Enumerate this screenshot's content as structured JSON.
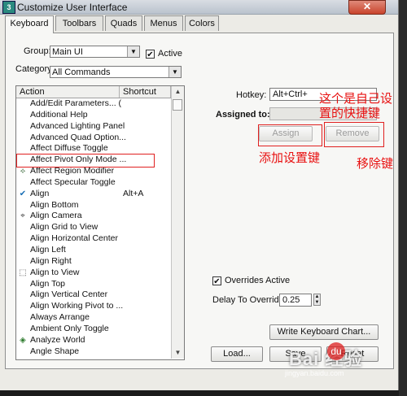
{
  "window": {
    "title": "Customize User Interface",
    "close_glyph": "✕",
    "app_icon": "3ds-max-icon"
  },
  "tabs": [
    {
      "label": "Keyboard",
      "active": true
    },
    {
      "label": "Toolbars",
      "active": false
    },
    {
      "label": "Quads",
      "active": false
    },
    {
      "label": "Menus",
      "active": false
    },
    {
      "label": "Colors",
      "active": false
    }
  ],
  "group": {
    "label": "Group:",
    "value": "Main UI",
    "active_label": "Active",
    "active_checked": true
  },
  "category": {
    "label": "Category:",
    "value": "All Commands"
  },
  "list": {
    "header_action": "Action",
    "header_shortcut": "Shortcut",
    "rows": [
      {
        "action": "Add/Edit Parameters... (",
        "shortcut": "",
        "icon": ""
      },
      {
        "action": "Additional Help",
        "shortcut": "",
        "icon": ""
      },
      {
        "action": "Advanced Lighting Panel",
        "shortcut": "",
        "icon": ""
      },
      {
        "action": "Advanced Quad Option...",
        "shortcut": "",
        "icon": ""
      },
      {
        "action": "Affect Diffuse Toggle",
        "shortcut": "",
        "icon": ""
      },
      {
        "action": "Affect Pivot Only Mode ...",
        "shortcut": "",
        "icon": ""
      },
      {
        "action": "Affect Region Modifier",
        "shortcut": "",
        "icon": "affect-region-icon"
      },
      {
        "action": "Affect Specular Toggle",
        "shortcut": "",
        "icon": ""
      },
      {
        "action": "Align",
        "shortcut": "Alt+A",
        "icon": "align-icon"
      },
      {
        "action": "Align Bottom",
        "shortcut": "",
        "icon": ""
      },
      {
        "action": "Align Camera",
        "shortcut": "",
        "icon": "align-camera-icon"
      },
      {
        "action": "Align Grid to View",
        "shortcut": "",
        "icon": ""
      },
      {
        "action": "Align Horizontal Center",
        "shortcut": "",
        "icon": ""
      },
      {
        "action": "Align Left",
        "shortcut": "",
        "icon": ""
      },
      {
        "action": "Align Right",
        "shortcut": "",
        "icon": ""
      },
      {
        "action": "Align to View",
        "shortcut": "",
        "icon": "align-to-view-icon"
      },
      {
        "action": "Align Top",
        "shortcut": "",
        "icon": ""
      },
      {
        "action": "Align Vertical Center",
        "shortcut": "",
        "icon": ""
      },
      {
        "action": "Align Working Pivot to ...",
        "shortcut": "",
        "icon": ""
      },
      {
        "action": "Always Arrange",
        "shortcut": "",
        "icon": ""
      },
      {
        "action": "Ambient Only Toggle",
        "shortcut": "",
        "icon": ""
      },
      {
        "action": "Analyze World",
        "shortcut": "",
        "icon": "analyze-world-icon"
      },
      {
        "action": "Angle Shape",
        "shortcut": "",
        "icon": ""
      }
    ]
  },
  "hotkey": {
    "label": "Hotkey:",
    "value": "Alt+Ctrl+"
  },
  "assigned": {
    "label": "Assigned to:",
    "value": ""
  },
  "buttons": {
    "assign": "Assign",
    "remove": "Remove",
    "write_chart": "Write Keyboard Chart...",
    "load": "Load...",
    "save": "Save",
    "reset": "Reset"
  },
  "overrides": {
    "label": "Overrides Active",
    "checked": true,
    "delay_label": "Delay To Override:",
    "delay_value": "0.25"
  },
  "annotations": {
    "hotkey_note_line1": "这个是自己设",
    "hotkey_note_line2": "置的快捷键",
    "assign_note": "添加设置键",
    "remove_note": "移除键"
  },
  "watermark": {
    "text": "Bai 经验",
    "paw": "du",
    "url": "jingyan.baidu.com"
  },
  "colors": {
    "annotation": "#e81010",
    "window_bg": "#ecebe6"
  }
}
